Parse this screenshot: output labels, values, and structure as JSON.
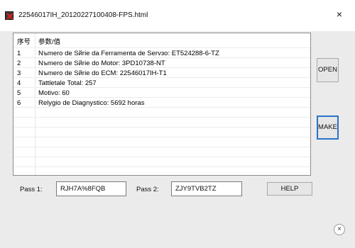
{
  "window": {
    "title": "22546017IH_20120227100408-FPS.html",
    "close_glyph": "×"
  },
  "list": {
    "headers": [
      "序号",
      "参数/值"
    ],
    "rows": [
      {
        "index": "1",
        "value": "Nъmero de Sйrie da Ferramenta de Servзo: ET524288-6-TZ"
      },
      {
        "index": "2",
        "value": "Nъmero de Sйrie do Motor: 3PD10738-NT"
      },
      {
        "index": "3",
        "value": "Nъmero de Sйrie do ECM: 22546017IH-T1"
      },
      {
        "index": "4",
        "value": "Tattletale Total: 257"
      },
      {
        "index": "5",
        "value": "Motivo: 60"
      },
      {
        "index": "6",
        "value": "Relуgio de Diagnуstico: 5692 horas"
      }
    ]
  },
  "buttons": {
    "open": "OPEN",
    "make": "MAKE",
    "help": "HELP"
  },
  "pass1": {
    "label": "Pass 1:",
    "value": "RJH7A%8FQB"
  },
  "pass2": {
    "label": "Pass 2:",
    "value": "ZJY9TVB2TZ"
  },
  "footer": {
    "close_glyph": "×"
  },
  "icons": {
    "app": "app-icon",
    "title_close": "close-icon",
    "footer_close": "close-circle-icon"
  }
}
